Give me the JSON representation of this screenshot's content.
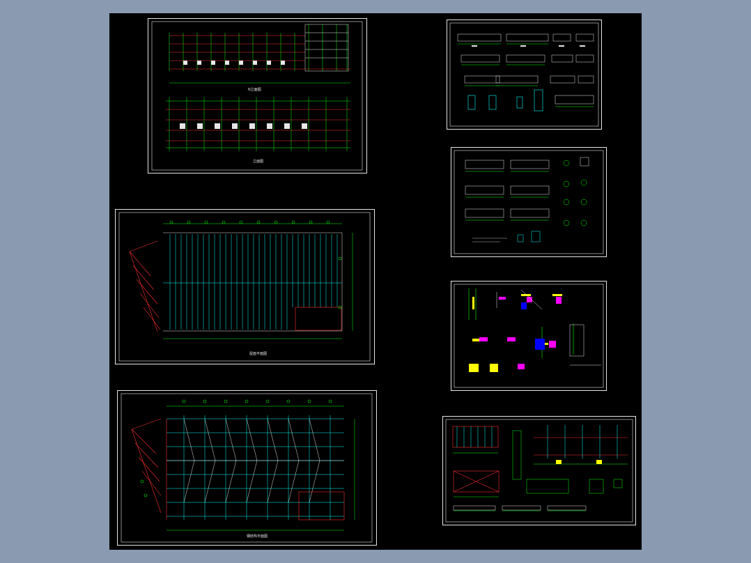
{
  "viewer": {
    "background_color": "#8a9bb1",
    "canvas_color": "#000000"
  },
  "sheets": [
    {
      "id": "elevations",
      "caption_top": "N立面图",
      "caption_bottom": "立面图"
    },
    {
      "id": "roof-plan",
      "caption": "屋面平面图"
    },
    {
      "id": "steel-plan",
      "caption": "钢结构平面图"
    },
    {
      "id": "beam-details",
      "caption": ""
    },
    {
      "id": "purlin-details",
      "caption": ""
    },
    {
      "id": "node-details",
      "caption": ""
    },
    {
      "id": "frame-details",
      "caption": ""
    }
  ],
  "colors": {
    "border": "#e6e6e6",
    "grid": "#00ff00",
    "beam": "#ff3030",
    "structure": "#00ffff",
    "accent": "#ffff00",
    "highlight": "#ff00ff",
    "steel": "#0000ff"
  }
}
